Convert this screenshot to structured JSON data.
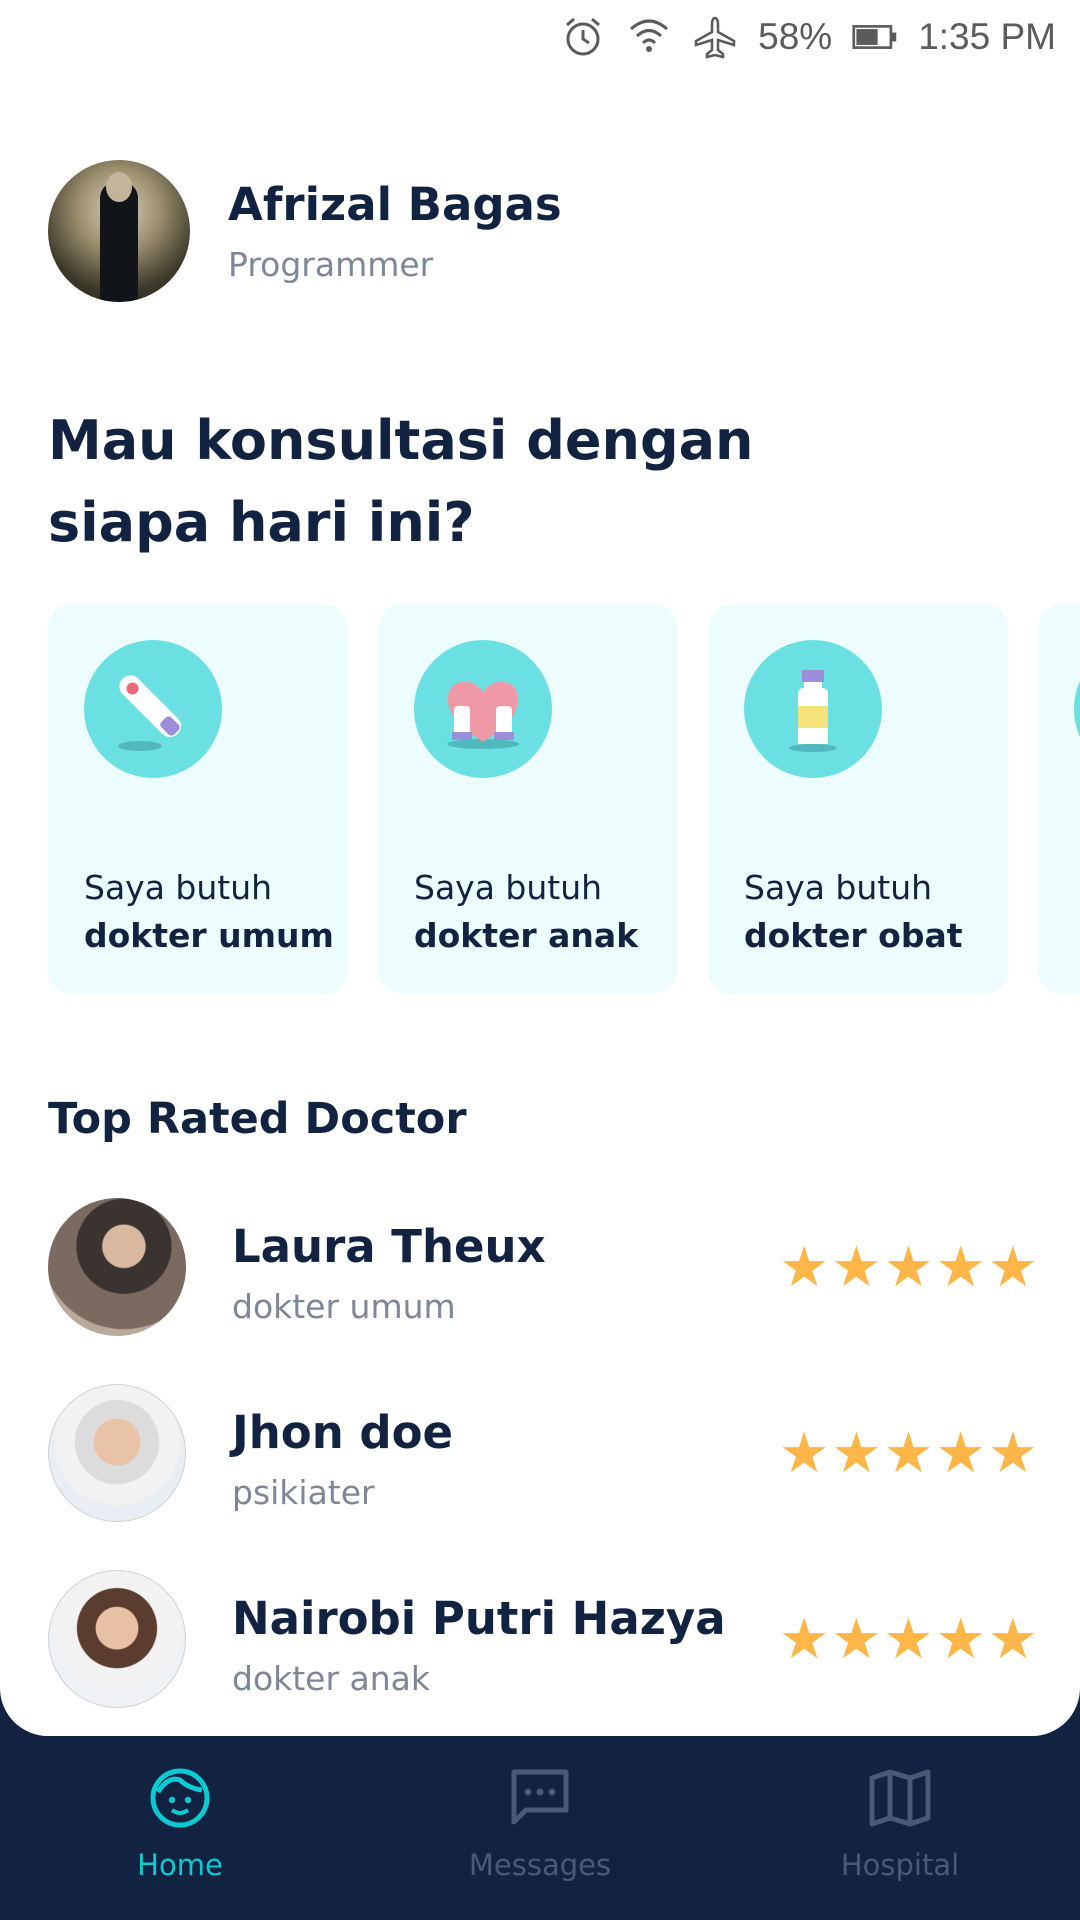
{
  "status_bar": {
    "battery_percent": "58%",
    "time": "1:35 PM",
    "icons": [
      "alarm-icon",
      "wifi-icon",
      "airplane-icon",
      "battery-icon"
    ]
  },
  "profile": {
    "name": "Afrizal Bagas",
    "job": "Programmer"
  },
  "headline": {
    "line1": "Mau konsultasi dengan",
    "line2": "siapa hari ini?"
  },
  "categories": [
    {
      "label": "Saya butuh",
      "category": "dokter umum",
      "icon": "thermometer-icon"
    },
    {
      "label": "Saya butuh",
      "category": "dokter anak",
      "icon": "heart-hands-icon"
    },
    {
      "label": "Saya butuh",
      "category": "dokter obat",
      "icon": "medicine-bottle-icon"
    }
  ],
  "top_rated_title": "Top Rated Doctor",
  "doctors": [
    {
      "name": "Laura Theux",
      "category": "dokter umum",
      "rating": 5
    },
    {
      "name": "Jhon doe",
      "category": "psikiater",
      "rating": 5
    },
    {
      "name": "Nairobi Putri Hazya",
      "category": "dokter anak",
      "rating": 5
    }
  ],
  "nav": {
    "home": "Home",
    "messages": "Messages",
    "hospital": "Hospital"
  },
  "colors": {
    "primary_dark": "#112340",
    "accent": "#0BCAD4",
    "card_bg": "#EDFCFD",
    "icon_circle": "#6BE0E3",
    "star": "#FFB648",
    "secondary_text": "#7D8797"
  }
}
